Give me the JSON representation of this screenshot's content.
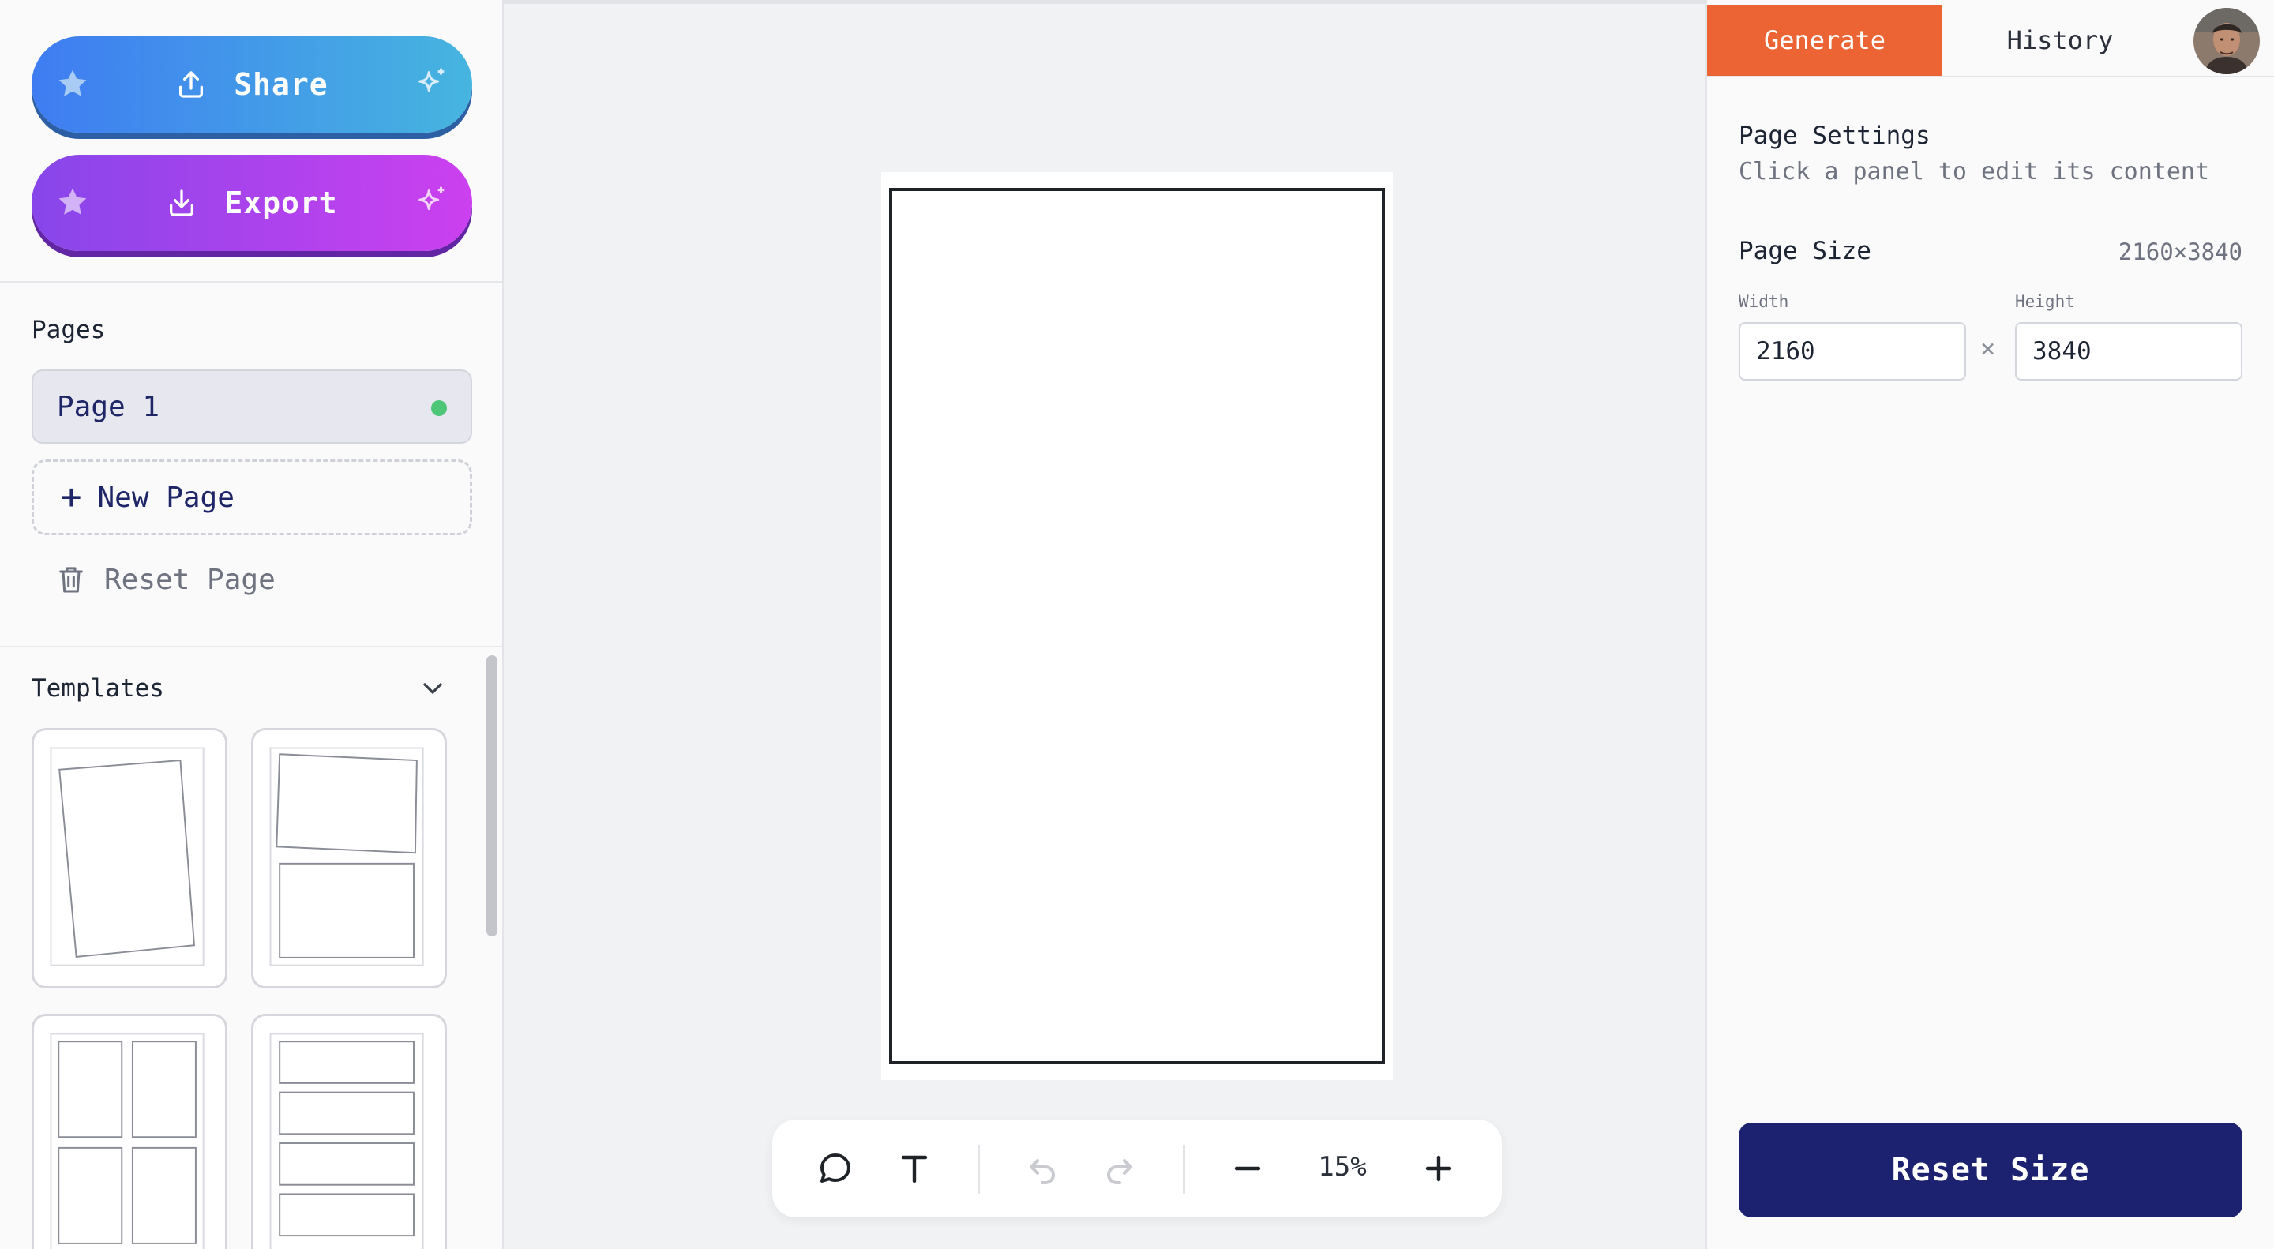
{
  "sidebar": {
    "share_label": "Share",
    "export_label": "Export",
    "pages_title": "Pages",
    "pages": [
      {
        "label": "Page 1",
        "active": true
      }
    ],
    "new_page_label": "New Page",
    "reset_page_label": "Reset Page",
    "templates_title": "Templates"
  },
  "toolbar": {
    "zoom_level": "15%",
    "icons": [
      "speech-bubble-icon",
      "text-icon",
      "undo-icon",
      "redo-icon",
      "zoom-out-icon",
      "zoom-in-icon"
    ]
  },
  "right_panel": {
    "tabs": [
      {
        "label": "Generate",
        "active": true
      },
      {
        "label": "History",
        "active": false
      }
    ],
    "page_settings_title": "Page Settings",
    "page_settings_subtitle": "Click a panel to edit its content",
    "page_size_label": "Page Size",
    "page_size_value": "2160×3840",
    "width_label": "Width",
    "height_label": "Height",
    "width_value": "2160",
    "height_value": "3840",
    "times_sign": "×",
    "reset_size_label": "Reset Size"
  },
  "colors": {
    "generate_tab": "#ed6434",
    "reset_size_button": "#1d2270",
    "share_gradient": [
      "#3f7cf2",
      "#46b5df"
    ],
    "export_gradient": [
      "#8746ea",
      "#cc40ef"
    ],
    "active_dot": "#4ec678"
  }
}
